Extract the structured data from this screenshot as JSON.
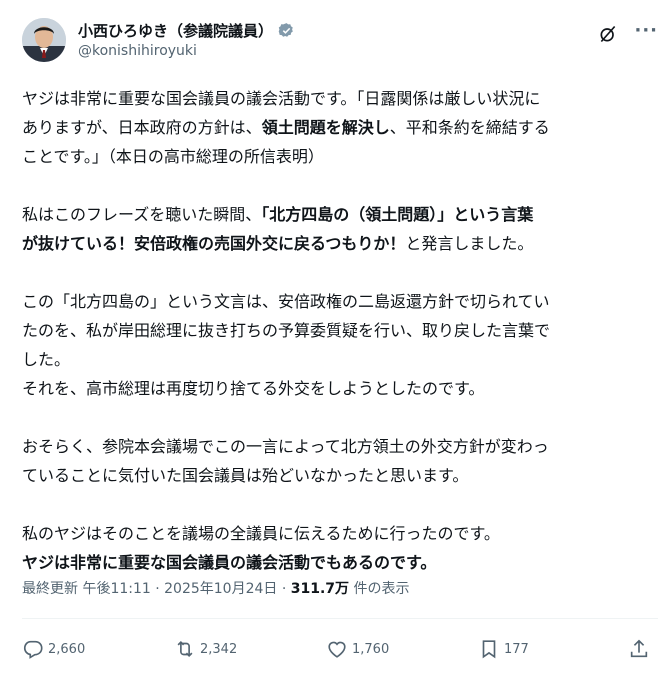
{
  "author": {
    "name": "小西ひろゆき（参議院議員）",
    "handle": "@konishihiroyuki"
  },
  "icons": {
    "verified": "verified-badge-icon",
    "grok": "grok-icon",
    "more": "more-icon",
    "reply": "reply-icon",
    "retweet": "retweet-icon",
    "like": "like-icon",
    "bookmark": "bookmark-icon",
    "share": "share-icon"
  },
  "colors": {
    "verified_badge": "#829aab",
    "text": "#0f1419",
    "muted": "#536471"
  },
  "tweet": {
    "p1": {
      "l1": "ヤジは非常に重要な国会議員の議会活動です。「日露関係は厳しい状況に",
      "l2a": "ありますが、日本政府の方針は、",
      "l2b": "領土問題を解決し",
      "l2c": "、平和条約を締結する",
      "l3": "ことです。」（本日の高市総理の所信表明）"
    },
    "p2": {
      "l1a": "私はこのフレーズを聴いた瞬間、",
      "l1b": "「北方四島の（領土問題）」という言葉",
      "l2a": "が抜けている！安倍政権の売国外交に戻るつもりか！",
      "l2b": "と発言しました。"
    },
    "p3": {
      "l1": "この「北方四島の」という文言は、安倍政権の二島返還方針で切られてい",
      "l2": "たのを、私が岸田総理に抜き打ちの予算委質疑を行い、取り戻した言葉で",
      "l3": "した。",
      "l4": "それを、高市総理は再度切り捨てる外交をしようとしたのです。"
    },
    "p4": {
      "l1": "おそらく、参院本会議場でこの一言によって北方領土の外交方針が変わっ",
      "l2": "ていることに気付いた国会議員は殆どいなかったと思います。"
    },
    "p5": {
      "l1": "私のヤジはそのことを議場の全議員に伝えるために行ったのです。",
      "l2": "ヤジは非常に重要な国会議員の議会活動でもあるのです。"
    }
  },
  "meta": {
    "updated": "最終更新 午後11:11 · 2025年10月24日 · ",
    "views_count": "311.7万",
    "views_label": " 件の表示"
  },
  "actions": {
    "replies": "2,660",
    "retweets": "2,342",
    "likes": "1,760",
    "bookmarks": "177"
  }
}
